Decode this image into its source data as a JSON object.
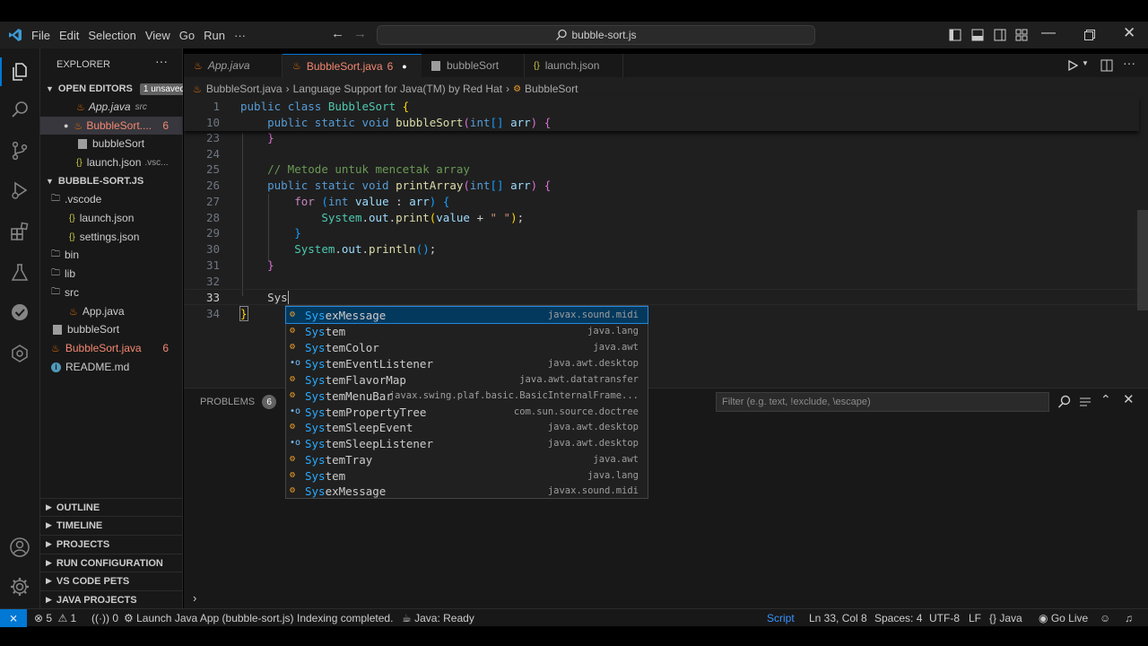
{
  "menu": [
    "File",
    "Edit",
    "Selection",
    "View",
    "Go",
    "Run",
    "···"
  ],
  "search": {
    "text": "bubble-sort.js"
  },
  "explorer": {
    "title": "EXPLORER",
    "open_editors": {
      "label": "OPEN EDITORS",
      "badge": "1 unsaved",
      "items": [
        {
          "name": "App.java",
          "desc": "src"
        },
        {
          "name": "BubbleSort....",
          "count": "6"
        },
        {
          "name": "bubbleSort"
        },
        {
          "name": "launch.json",
          "desc": ".vsc..."
        }
      ]
    },
    "folder": {
      "label": "BUBBLE-SORT.JS",
      "items": [
        {
          "name": ".vscode"
        },
        {
          "name": "launch.json"
        },
        {
          "name": "settings.json"
        },
        {
          "name": "bin"
        },
        {
          "name": "lib"
        },
        {
          "name": "src"
        },
        {
          "name": "App.java"
        },
        {
          "name": "bubbleSort"
        },
        {
          "name": "BubbleSort.java",
          "count": "6"
        },
        {
          "name": "README.md"
        }
      ]
    },
    "sections": [
      "OUTLINE",
      "TIMELINE",
      "PROJECTS",
      "RUN CONFIGURATION",
      "VS CODE PETS",
      "JAVA PROJECTS"
    ]
  },
  "tabs": [
    {
      "label": "App.java"
    },
    {
      "label": "BubbleSort.java",
      "count": "6"
    },
    {
      "label": "bubbleSort"
    },
    {
      "label": "launch.json"
    }
  ],
  "breadcrumb": [
    "BubbleSort.java",
    "Language Support for Java(TM) by Red Hat",
    "BubbleSort"
  ],
  "code": {
    "sticky": [
      {
        "n": "1",
        "text": "public class BubbleSort {"
      },
      {
        "n": "10",
        "text": "    public static void bubbleSort(int[] arr) {"
      }
    ],
    "lines": [
      {
        "n": "23",
        "text": "    }"
      },
      {
        "n": "24",
        "text": ""
      },
      {
        "n": "25",
        "text": "    // Metode untuk mencetak array"
      },
      {
        "n": "26",
        "text": "    public static void printArray(int[] arr) {"
      },
      {
        "n": "27",
        "text": "        for (int value : arr) {"
      },
      {
        "n": "28",
        "text": "            System.out.print(value + \" \");"
      },
      {
        "n": "29",
        "text": "        }"
      },
      {
        "n": "30",
        "text": "        System.out.println();"
      },
      {
        "n": "31",
        "text": "    }"
      },
      {
        "n": "32",
        "text": ""
      },
      {
        "n": "33",
        "text": "    Sys"
      },
      {
        "n": "34",
        "text": "}"
      }
    ]
  },
  "suggestions": [
    {
      "label": "SysexMessage",
      "detail": "javax.sound.midi",
      "kind": "class"
    },
    {
      "label": "System",
      "detail": "java.lang",
      "kind": "class"
    },
    {
      "label": "SystemColor",
      "detail": "java.awt",
      "kind": "class"
    },
    {
      "label": "SystemEventListener",
      "detail": "java.awt.desktop",
      "kind": "interface"
    },
    {
      "label": "SystemFlavorMap",
      "detail": "java.awt.datatransfer",
      "kind": "class"
    },
    {
      "label": "SystemMenuBar",
      "detail": "javax.swing.plaf.basic.BasicInternalFrame...",
      "kind": "class"
    },
    {
      "label": "SystemPropertyTree",
      "detail": "com.sun.source.doctree",
      "kind": "interface"
    },
    {
      "label": "SystemSleepEvent",
      "detail": "java.awt.desktop",
      "kind": "class"
    },
    {
      "label": "SystemSleepListener",
      "detail": "java.awt.desktop",
      "kind": "interface"
    },
    {
      "label": "SystemTray",
      "detail": "java.awt",
      "kind": "class"
    },
    {
      "label": "System",
      "detail": "java.lang",
      "kind": "class"
    },
    {
      "label": "SysexMessage",
      "detail": "javax.sound.midi",
      "kind": "class"
    }
  ],
  "panel": {
    "tab": "PROBLEMS",
    "count": "6",
    "filter_placeholder": "Filter (e.g. text, !exclude, \\escape)"
  },
  "status": {
    "errors": "5",
    "warnings": "1",
    "ports": "0",
    "launch": "Launch Java App (bubble-sort.js)",
    "indexing": "Indexing completed.",
    "java": "Java: Ready",
    "script": "Script",
    "position": "Ln 33, Col 8",
    "spaces": "Spaces: 4",
    "encoding": "UTF-8",
    "eol": "LF",
    "language": "Java",
    "golive": "Go Live"
  },
  "colors": {
    "accent": "#0078d4",
    "match": "#2aaaff",
    "modified": "#e2c08d",
    "error": "#f48771"
  }
}
